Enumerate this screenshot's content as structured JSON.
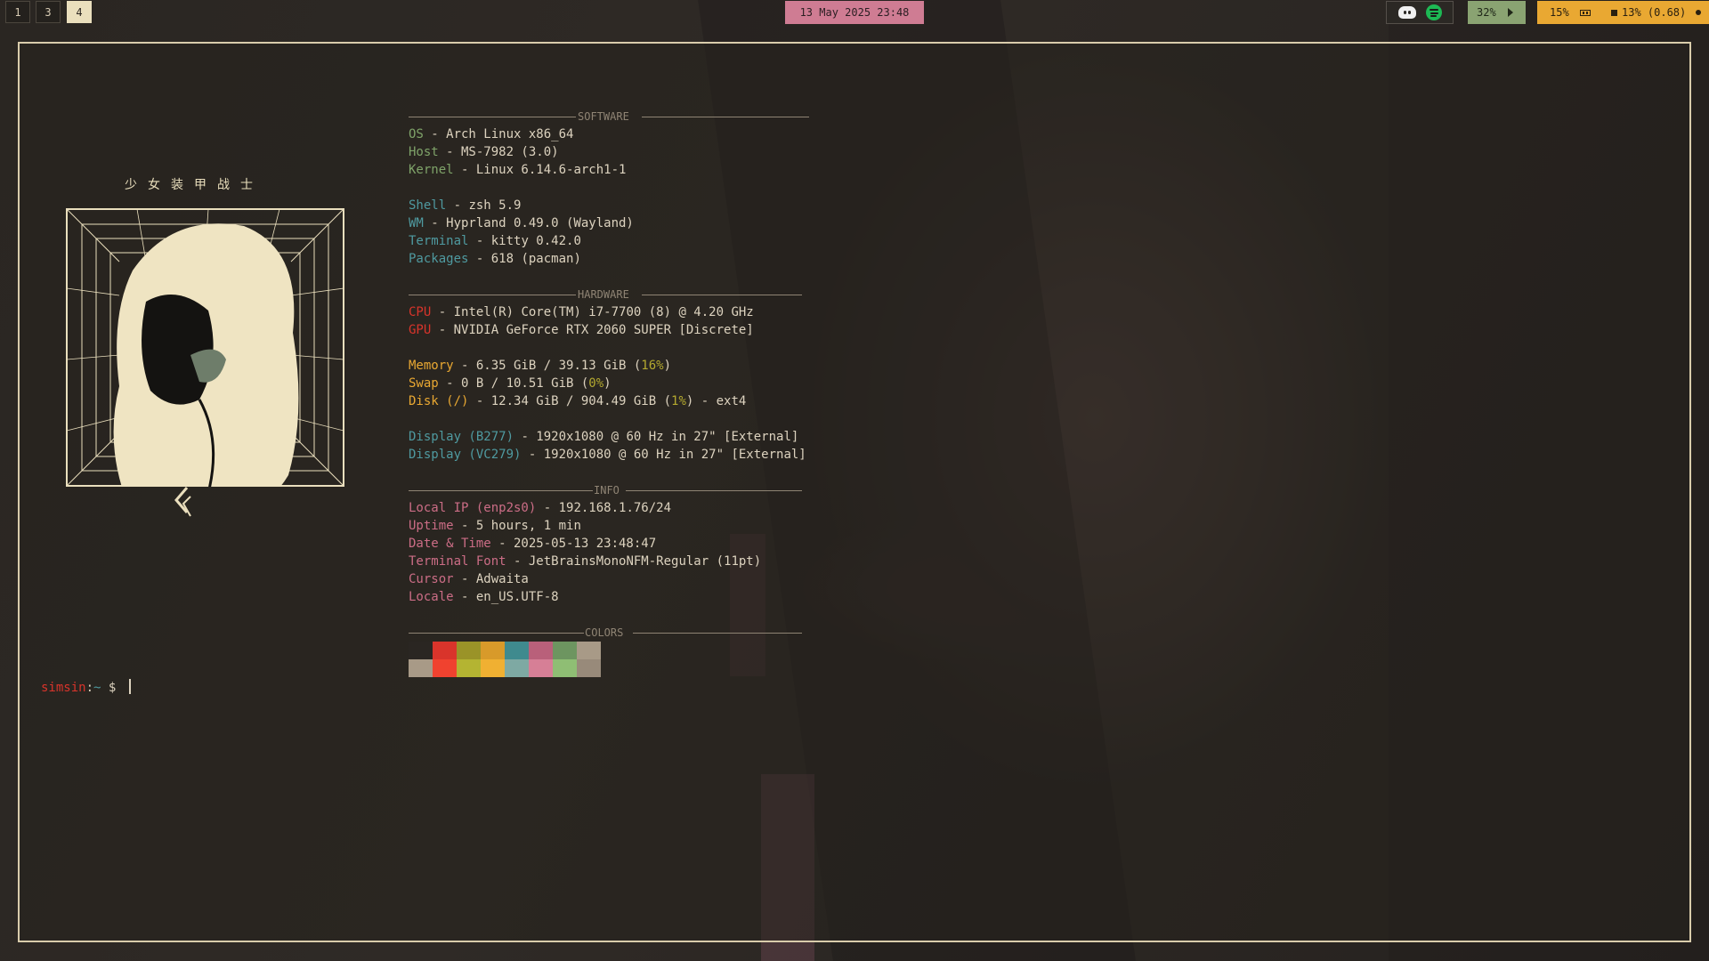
{
  "topbar": {
    "workspaces": [
      "1",
      "3",
      "4"
    ],
    "active_workspace": "4",
    "clock": "13 May 2025   23:48",
    "tray_icons": [
      "discord-icon",
      "spotify-icon"
    ],
    "volume": "32%",
    "memory": "15%",
    "cpu": "13% (0.68)"
  },
  "terminal": {
    "logo_title": "少女装甲战士",
    "prompt_user": "simsin",
    "prompt_sep": ":",
    "prompt_path": "~",
    "prompt_symbol": " $ "
  },
  "fetch": {
    "software_header": "SOFTWARE",
    "hardware_header": "HARDWARE",
    "info_header": "INFO",
    "colors_header": "COLORS",
    "software": [
      {
        "key": "OS",
        "value": " - Arch Linux x86_64"
      },
      {
        "key": "Host",
        "value": " - MS-7982 (3.0)"
      },
      {
        "key": "Kernel",
        "value": " - Linux 6.14.6-arch1-1"
      },
      {
        "key": "Shell",
        "value": " - zsh 5.9"
      },
      {
        "key": "WM",
        "value": " - Hyprland 0.49.0 (Wayland)"
      },
      {
        "key": "Terminal",
        "value": " - kitty 0.42.0"
      },
      {
        "key": "Packages",
        "value": " - 618 (pacman)"
      }
    ],
    "hardware": [
      {
        "key": "CPU",
        "value": " - Intel(R) Core(TM) i7-7700 (8) @ 4.20 GHz"
      },
      {
        "key": "GPU",
        "value": " - NVIDIA GeForce RTX 2060 SUPER [Discrete]"
      },
      {
        "key": "Memory",
        "value": " - 6.35 GiB / 39.13 GiB (",
        "pct": "16%",
        "tail": ")"
      },
      {
        "key": "Swap",
        "value": " - 0 B / 10.51 GiB (",
        "pct": "0%",
        "tail": ")"
      },
      {
        "key": "Disk (/)",
        "value": " - 12.34 GiB / 904.49 GiB (",
        "pct": "1%",
        "tail": ") - ext4"
      },
      {
        "key": "Display (B277)",
        "value": " - 1920x1080 @ 60 Hz in 27\" [External]"
      },
      {
        "key": "Display (VC279)",
        "value": " - 1920x1080 @ 60 Hz in 27\" [External]"
      }
    ],
    "info": [
      {
        "key": "Local IP (enp2s0)",
        "value": " - 192.168.1.76/24"
      },
      {
        "key": "Uptime",
        "value": " - 5 hours, 1 min"
      },
      {
        "key": "Date & Time",
        "value": " - 2025-05-13 23:48:47"
      },
      {
        "key": "Terminal Font",
        "value": " - JetBrainsMonoNFM-Regular (11pt)"
      },
      {
        "key": "Cursor",
        "value": " - Adwaita"
      },
      {
        "key": "Locale",
        "value": " - en_US.UTF-8"
      }
    ],
    "colors_top": [
      "#2a2622",
      "#d9342b",
      "#9a9328",
      "#d89a2a",
      "#3f8a8e",
      "#b9607a",
      "#6d9560",
      "#a89a87"
    ],
    "colors_bottom": [
      "#a89a87",
      "#f0422f",
      "#b4b432",
      "#f0b032",
      "#7ea9a3",
      "#d67f96",
      "#8fbe74",
      "#988a7a"
    ]
  }
}
